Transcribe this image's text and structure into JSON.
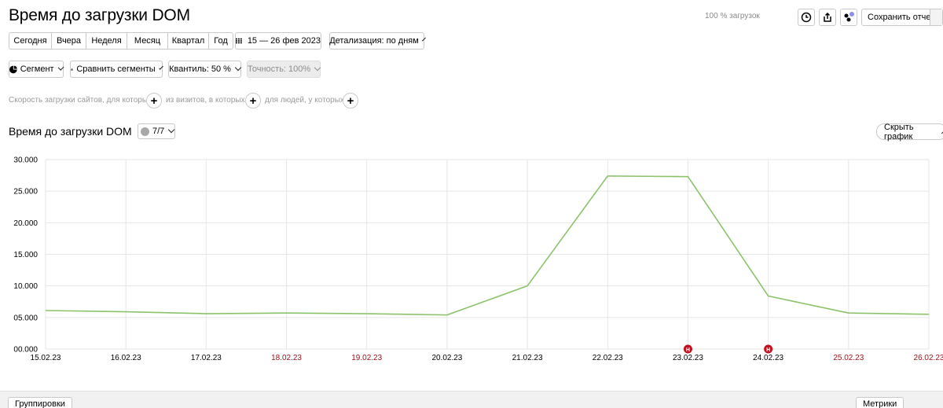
{
  "header": {
    "title": "Время до загрузки DOM",
    "progress": "100 % загрузок",
    "save_label": "Сохранить отчет"
  },
  "toolbar": {
    "periods": [
      "Сегодня",
      "Вчера",
      "Неделя",
      "Месяц",
      "Квартал",
      "Год"
    ],
    "date_range": "15 — 26 фев 2023",
    "detail": "Детализация: по дням"
  },
  "segments": {
    "segment": "Сегмент",
    "compare": "Сравнить сегменты",
    "quantile": "Квантиль: 50 %",
    "accuracy": "Точность: 100%"
  },
  "filters": {
    "part1": "Скорость загрузки сайтов, для которых",
    "part2": "из визитов, в которых",
    "part3": "для людей, у которых",
    "plus": "+"
  },
  "chart_section": {
    "title": "Время до загрузки DOM",
    "count": "7/7",
    "hide": "Скрыть график"
  },
  "footer": {
    "groupings": "Группировки",
    "metrics": "Метрики"
  },
  "colors": {
    "line": "#8cc26b",
    "holiday": "#a0131a",
    "marker": "#c4101e",
    "grid": "#e6e6e6"
  },
  "chart_data": {
    "type": "line",
    "x": [
      "15.02.23",
      "16.02.23",
      "17.02.23",
      "18.02.23",
      "19.02.23",
      "20.02.23",
      "21.02.23",
      "22.02.23",
      "23.02.23",
      "24.02.23",
      "25.02.23",
      "26.02.23"
    ],
    "holidays": [
      "18.02.23",
      "19.02.23",
      "25.02.23",
      "26.02.23"
    ],
    "y_ticks": [
      "00.000",
      "05.000",
      "10.000",
      "15.000",
      "20.000",
      "25.000",
      "30.000"
    ],
    "ylim": [
      0,
      30
    ],
    "series": [
      {
        "values": [
          6.1,
          5.9,
          5.6,
          5.7,
          5.6,
          5.4,
          10.0,
          27.4,
          27.3,
          8.4,
          5.7,
          5.5
        ]
      }
    ],
    "markers": [
      {
        "x": "23.02.23",
        "label": "Н"
      },
      {
        "x": "24.02.23",
        "label": "Н"
      }
    ],
    "grid": true
  }
}
